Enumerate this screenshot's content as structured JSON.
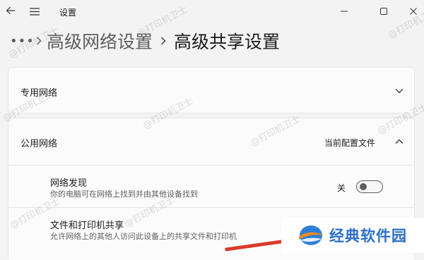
{
  "window": {
    "title": "设置"
  },
  "breadcrumb": {
    "more": "•••",
    "parent": "高级网络设置",
    "current": "高级共享设置"
  },
  "private_network": {
    "label": "专用网络"
  },
  "public_network": {
    "label": "公用网络",
    "link": "当前配置文件",
    "settings": [
      {
        "title": "网络发现",
        "description": "你的电脑可在网络上找到并由其他设备找到",
        "state": "关"
      },
      {
        "title": "文件和打印机共享",
        "description": "允许网络上的其他人访问此设备上的共享文件和打印机"
      }
    ]
  },
  "watermark": "@打印机卫士",
  "logo": {
    "text": "经典软件园"
  },
  "icons": [
    "back-arrow-icon",
    "hamburger-menu-icon",
    "minimize-icon",
    "maximize-icon",
    "close-icon",
    "chevron-right-icon",
    "chevron-down-icon",
    "chevron-up-icon"
  ]
}
